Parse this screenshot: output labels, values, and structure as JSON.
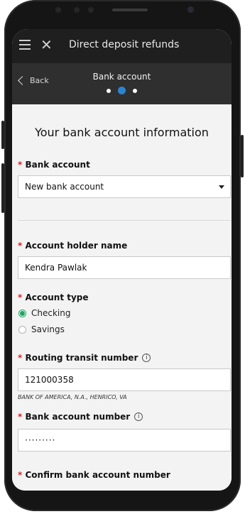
{
  "topbar": {
    "title": "Direct deposit refunds"
  },
  "subbar": {
    "back_label": "Back",
    "step_title": "Bank account",
    "steps": 3,
    "current_step": 2
  },
  "section": {
    "title": "Your bank account information"
  },
  "bank_account": {
    "label": "Bank account",
    "value": "New bank account"
  },
  "holder": {
    "label": "Account holder name",
    "value": "Kendra Pawlak"
  },
  "account_type": {
    "label": "Account type",
    "options": [
      {
        "label": "Checking",
        "checked": true
      },
      {
        "label": "Savings",
        "checked": false
      }
    ]
  },
  "routing": {
    "label": "Routing transit number",
    "value": "121000358",
    "bank_name": "BANK OF AMERICA, N.A., HENRICO, VA"
  },
  "acct_number": {
    "label": "Bank account number",
    "value": "·········"
  },
  "confirm": {
    "label": "Confirm bank account number"
  },
  "required_marker": "*",
  "info_glyph": "i",
  "colors": {
    "topbar": "#1f1f1f",
    "subbar": "#2f2f2f",
    "active_step": "#2a85d0",
    "radio_checked": "#23a362",
    "required": "#dd2222"
  }
}
